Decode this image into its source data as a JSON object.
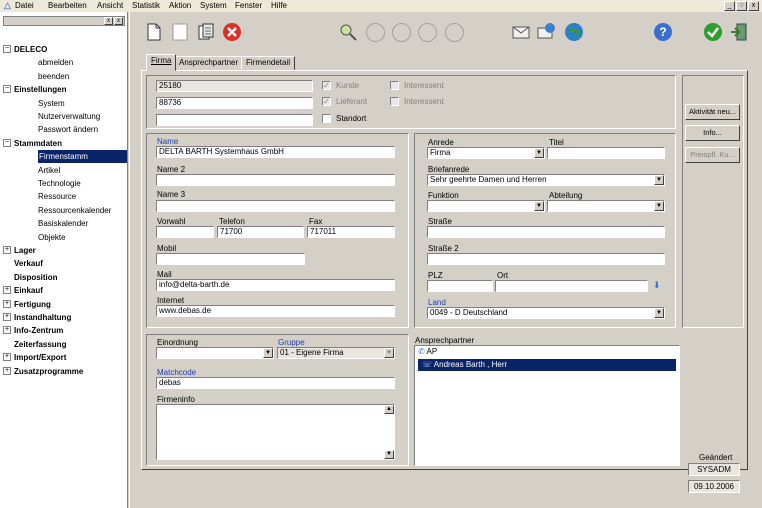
{
  "menu": [
    "Datei",
    "Bearbeiten",
    "Ansicht",
    "Statistik",
    "Aktion",
    "System",
    "Fenster",
    "Hilfe"
  ],
  "window_buttons": [
    "_",
    "♢",
    "x"
  ],
  "sidebar_close": [
    "x",
    "x"
  ],
  "tree": [
    {
      "label": "DELECO",
      "level": 0,
      "bold": true,
      "expander": "⊟"
    },
    {
      "label": "abmelden",
      "level": 2
    },
    {
      "label": "beenden",
      "level": 2
    },
    {
      "label": "Einstellungen",
      "level": 0,
      "bold": true,
      "expander": "⊟"
    },
    {
      "label": "System",
      "level": 2
    },
    {
      "label": "Nutzerverwaltung",
      "level": 2
    },
    {
      "label": "Passwort ändern",
      "level": 2
    },
    {
      "label": "Stammdaten",
      "level": 0,
      "bold": true,
      "expander": "⊟"
    },
    {
      "label": "Firmenstamm",
      "level": 2,
      "selected": true
    },
    {
      "label": "Artikel",
      "level": 2
    },
    {
      "label": "Technologie",
      "level": 2
    },
    {
      "label": "Ressource",
      "level": 2
    },
    {
      "label": "Ressourcenkalender",
      "level": 2
    },
    {
      "label": "Basiskalender",
      "level": 2
    },
    {
      "label": "Objekte",
      "level": 2
    },
    {
      "label": "Lager",
      "level": 0,
      "bold": true,
      "expander": "⊞"
    },
    {
      "label": "Verkauf",
      "level": 1,
      "bold": true
    },
    {
      "label": "Disposition",
      "level": 1,
      "bold": true
    },
    {
      "label": "Einkauf",
      "level": 0,
      "bold": true,
      "expander": "⊞"
    },
    {
      "label": "Fertigung",
      "level": 0,
      "bold": true,
      "expander": "⊞"
    },
    {
      "label": "Instandhaltung",
      "level": 0,
      "bold": true,
      "expander": "⊞"
    },
    {
      "label": "Info-Zentrum",
      "level": 0,
      "bold": true,
      "expander": "⊞"
    },
    {
      "label": "Zeiterfassung",
      "level": 1,
      "bold": true
    },
    {
      "label": "Import/Export",
      "level": 0,
      "bold": true,
      "expander": "⊞"
    },
    {
      "label": "Zusatzprogramme",
      "level": 0,
      "bold": true,
      "expander": "⊞"
    }
  ],
  "toolbar_icons": [
    "new-icon",
    "blank-icon",
    "copy-icon",
    "delete-icon",
    "search-icon",
    "circle-icon",
    "circle-icon",
    "circle-icon",
    "circle-icon",
    "mail-icon",
    "mail-send-icon",
    "globe-icon",
    "help-icon",
    "ok-icon",
    "exit-icon"
  ],
  "tabs": [
    "Firma",
    "Ansprechpartner",
    "Firmendetail"
  ],
  "top": {
    "field1": "25180",
    "field2": "88736",
    "field3": "",
    "kunde": "Kunde",
    "lieferant": "Lieferant",
    "standort": "Standort",
    "interessent1": "Interessent",
    "interessent2": "Interessent"
  },
  "right_buttons": [
    "Aktivität neu...",
    "Info...",
    "Preispfl. Ku..."
  ],
  "address": {
    "name_label": "Name",
    "name": "DELTA BARTH Systemhaus GmbH",
    "name2_label": "Name 2",
    "name2": "",
    "name3_label": "Name 3",
    "name3": "",
    "vorwahl_label": "Vorwahl",
    "vorwahl": "",
    "telefon_label": "Telefon",
    "telefon": "71700",
    "fax_label": "Fax",
    "fax": "717011",
    "mobil_label": "Mobil",
    "mobil": "",
    "mail_label": "Mail",
    "mail": "info@delta-barth.de",
    "internet_label": "Internet",
    "internet": "www.debas.de"
  },
  "contact": {
    "anrede_label": "Anrede",
    "anrede": "Firma",
    "titel_label": "Titel",
    "titel": "",
    "briefanrede_label": "Briefanrede",
    "briefanrede": "Sehr geehrte Damen und Herren",
    "funktion_label": "Funktion",
    "funktion": "",
    "abteilung_label": "Abteilung",
    "abteilung": "",
    "strasse_label": "Straße",
    "strasse": "",
    "strasse2_label": "Straße 2",
    "strasse2": "",
    "plz_label": "PLZ",
    "plz": "",
    "ort_label": "Ort",
    "ort": "",
    "land_label": "Land",
    "land": "0049 - D Deutschland"
  },
  "bottom": {
    "einordnung_label": "Einordnung",
    "einordnung": "",
    "gruppe_label": "Gruppe",
    "gruppe": "01 - Eigene Firma",
    "matchcode_label": "Matchcode",
    "matchcode": "debas",
    "firmeninfo_label": "Firmeninfo",
    "firmeninfo": ""
  },
  "ansprechpartner": {
    "label": "Ansprechpartner",
    "root": "AP",
    "person": "Andreas Barth  , Herr"
  },
  "status": {
    "geaendert_label": "Geändert",
    "user": "SYSADM",
    "date": "09.10.2006"
  }
}
